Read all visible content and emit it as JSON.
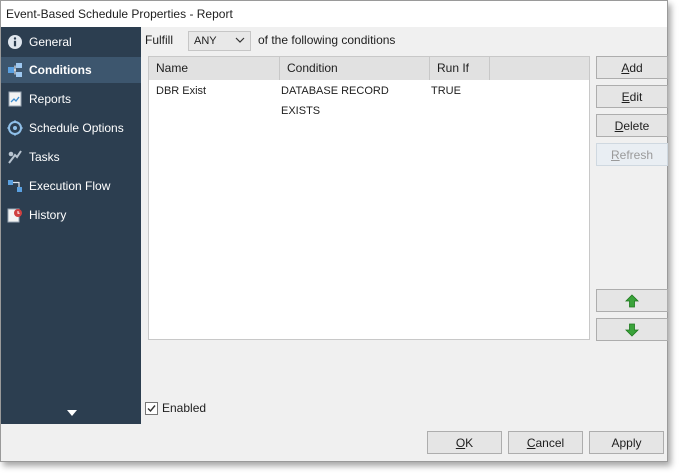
{
  "window": {
    "title": "Event-Based Schedule Properties - Report"
  },
  "sidebar": {
    "items": [
      {
        "label": "General",
        "icon": "info-icon",
        "active": false
      },
      {
        "label": "Conditions",
        "icon": "conditions-icon",
        "active": true
      },
      {
        "label": "Reports",
        "icon": "reports-icon",
        "active": false
      },
      {
        "label": "Schedule Options",
        "icon": "schedule-options-icon",
        "active": false
      },
      {
        "label": "Tasks",
        "icon": "tasks-icon",
        "active": false
      },
      {
        "label": "Execution Flow",
        "icon": "execution-flow-icon",
        "active": false
      },
      {
        "label": "History",
        "icon": "history-icon",
        "active": false
      }
    ],
    "scroll_icon": "down-arrow-icon"
  },
  "fulfill": {
    "label": "Fulfill",
    "selected": "ANY",
    "suffix": "of the following conditions"
  },
  "conditions_table": {
    "columns": [
      "Name",
      "Condition",
      "Run If"
    ],
    "rows": [
      {
        "name": "DBR Exist",
        "condition": "DATABASE RECORD EXISTS",
        "run_if": "TRUE"
      }
    ]
  },
  "actions": {
    "add_access": "A",
    "add_rest": "dd",
    "edit_access": "E",
    "edit_rest": "dit",
    "delete_access": "D",
    "delete_rest": "elete",
    "refresh_access": "R",
    "refresh_rest": "efresh",
    "move_up_icon": "up-arrow-icon",
    "move_down_icon": "down-arrow-icon"
  },
  "enabled": {
    "label": "Enabled",
    "checked": true
  },
  "footer": {
    "ok_access": "O",
    "ok_rest": "K",
    "cancel_access": "C",
    "cancel_rest": "ancel",
    "apply_label": "Apply"
  },
  "colors": {
    "sidebar_bg": "#2c3e50",
    "sidebar_active": "#3d566e",
    "arrow_green": "#3aa33a"
  }
}
